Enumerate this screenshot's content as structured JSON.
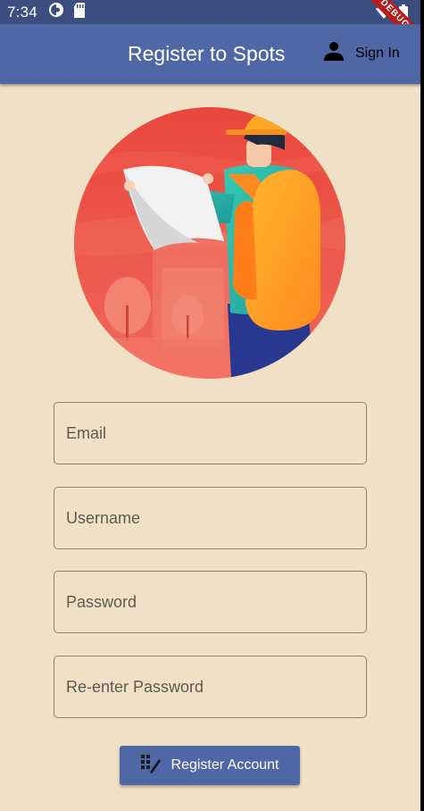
{
  "status_bar": {
    "time": "7:34",
    "debug_label": "DEBUG"
  },
  "app_bar": {
    "title": "Register to Spots",
    "sign_in_label": "Sign In",
    "sign_in_icon": "person-icon"
  },
  "illustration": {
    "subject": "explorer-with-map-icon"
  },
  "form": {
    "email_placeholder": "Email",
    "username_placeholder": "Username",
    "password_placeholder": "Password",
    "reenter_password_placeholder": "Re-enter Password"
  },
  "register_button": {
    "label": "Register Account",
    "icon": "draw-icon"
  },
  "colors": {
    "background": "#f0e1c6",
    "app_bar": "#4f67a4",
    "status_bar": "#3a4f7f",
    "accent": "#4f67a4",
    "illustration_red": "#e84f3f",
    "backpack_orange": "#ffa726",
    "jacket_teal": "#2bb5a5"
  }
}
